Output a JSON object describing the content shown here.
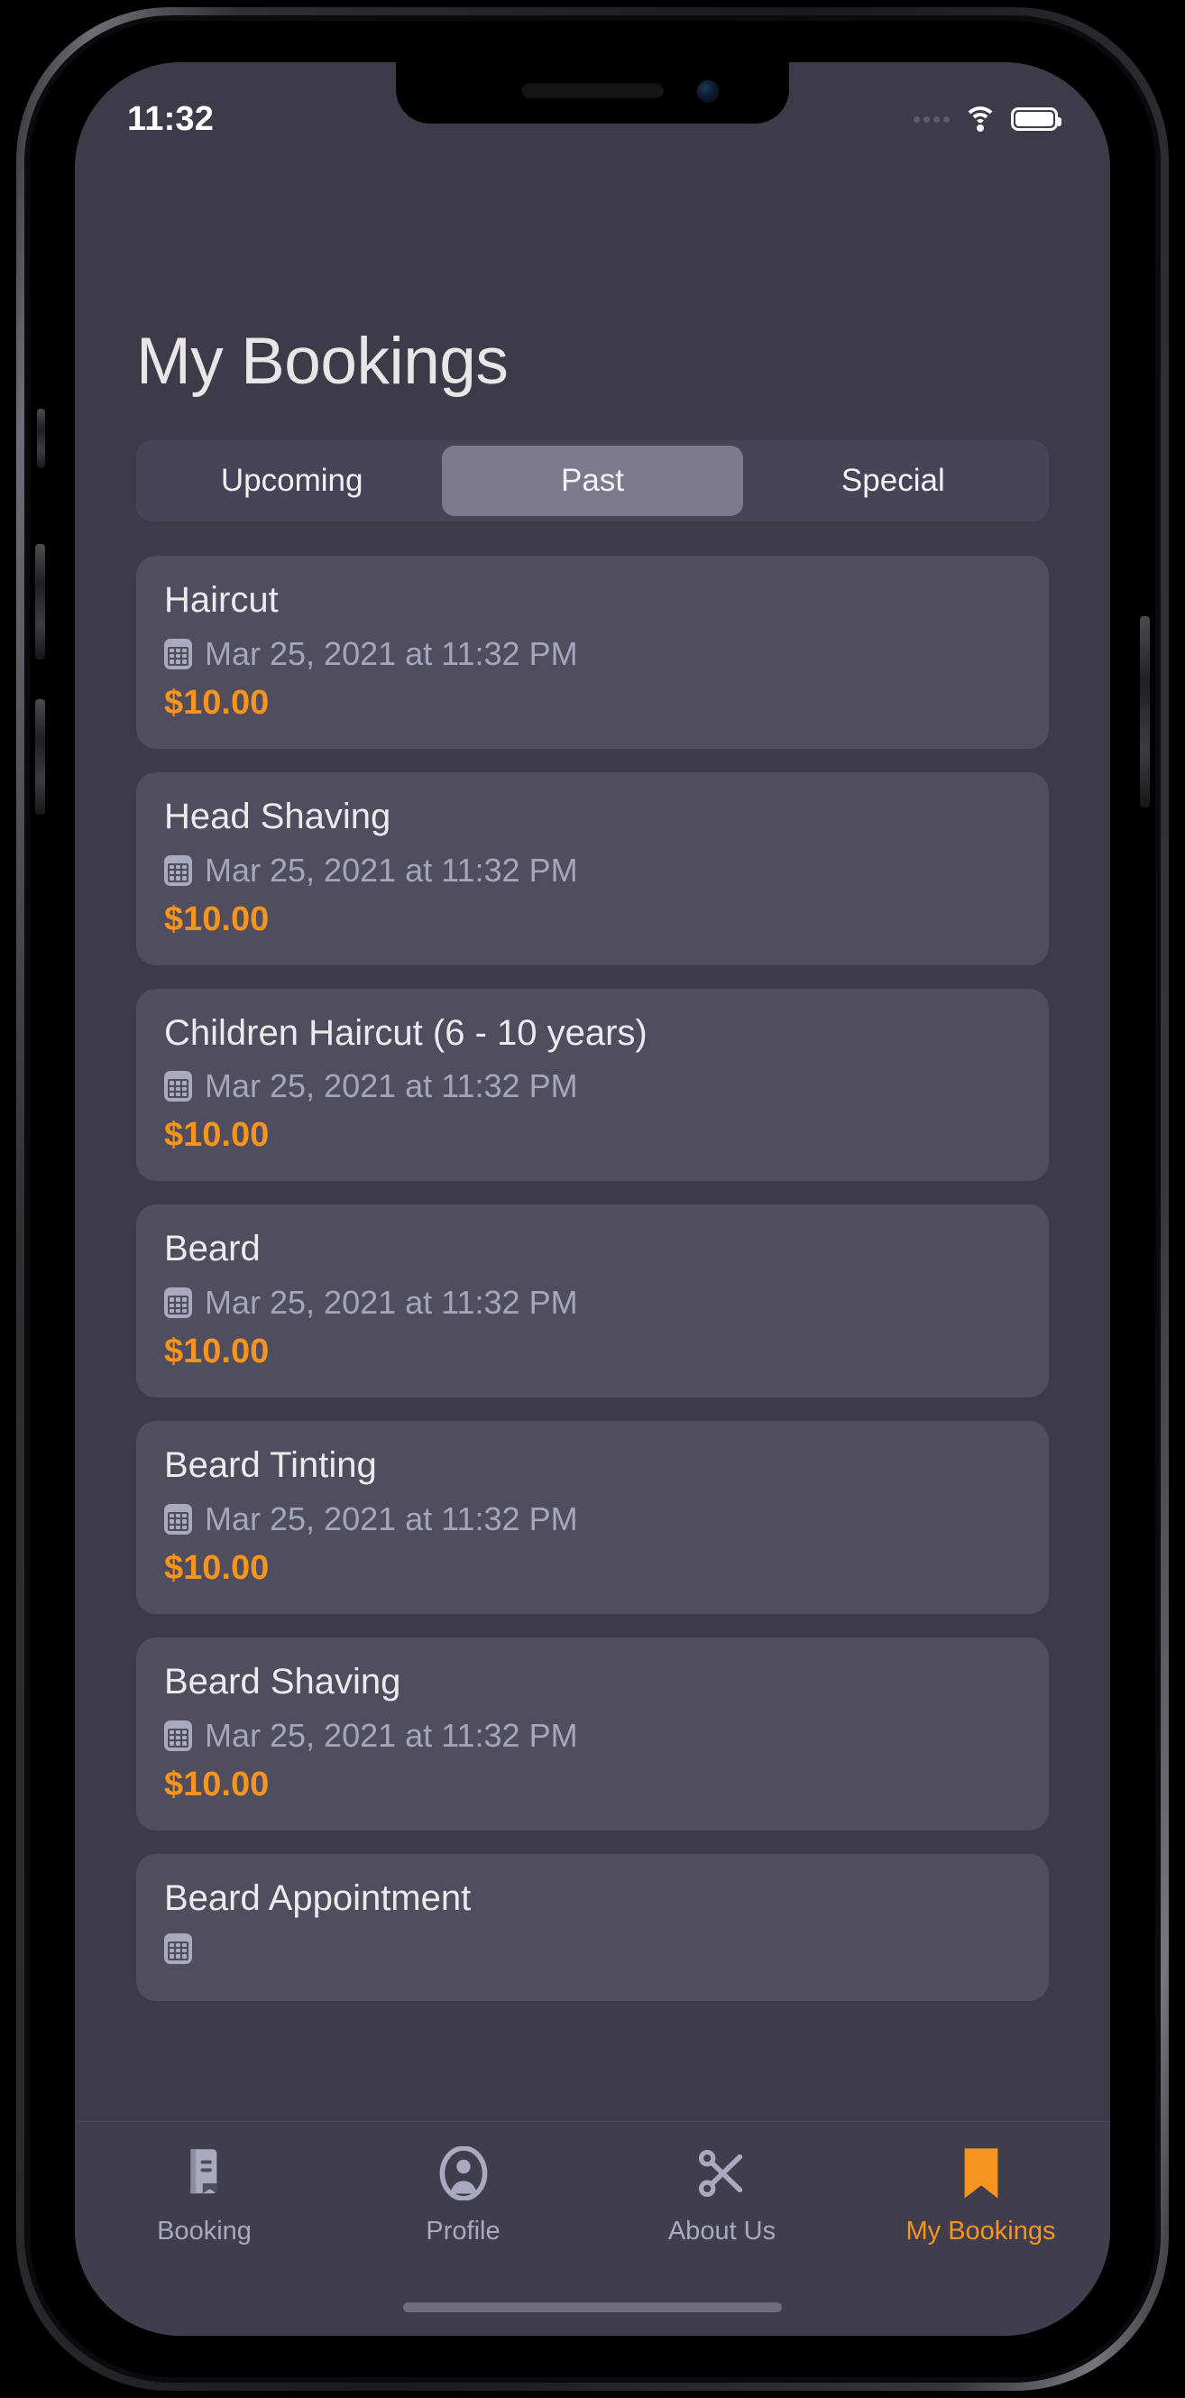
{
  "status_bar": {
    "time": "11:32",
    "signal_icon": "signal-dots-icon",
    "wifi_icon": "wifi-icon",
    "battery_icon": "battery-full-icon"
  },
  "header": {
    "title": "My Bookings"
  },
  "segmented_control": {
    "options": [
      {
        "label": "Upcoming",
        "selected": false
      },
      {
        "label": "Past",
        "selected": true
      },
      {
        "label": "Special",
        "selected": false
      }
    ]
  },
  "bookings": [
    {
      "service": "Haircut",
      "date": "Mar 25, 2021 at 11:32 PM",
      "price": "$10.00"
    },
    {
      "service": "Head Shaving",
      "date": "Mar 25, 2021 at 11:32 PM",
      "price": "$10.00"
    },
    {
      "service": "Children Haircut (6 - 10 years)",
      "date": "Mar 25, 2021 at 11:32 PM",
      "price": "$10.00"
    },
    {
      "service": "Beard",
      "date": "Mar 25, 2021 at 11:32 PM",
      "price": "$10.00"
    },
    {
      "service": "Beard Tinting",
      "date": "Mar 25, 2021 at 11:32 PM",
      "price": "$10.00"
    },
    {
      "service": "Beard Shaving",
      "date": "Mar 25, 2021 at 11:32 PM",
      "price": "$10.00"
    },
    {
      "service": "Beard Appointment",
      "date": "",
      "price": ""
    }
  ],
  "tab_bar": {
    "items": [
      {
        "label": "Booking",
        "icon": "book-icon",
        "active": false
      },
      {
        "label": "Profile",
        "icon": "person-circle-icon",
        "active": false
      },
      {
        "label": "About Us",
        "icon": "scissors-icon",
        "active": false
      },
      {
        "label": "My Bookings",
        "icon": "bookmark-icon",
        "active": true
      }
    ]
  },
  "colors": {
    "accent": "#f5941f",
    "background": "#3d3a4a",
    "card": "#504d5f",
    "segment_track": "#474457",
    "segment_active": "#7d7a8d",
    "muted_text": "#a3a6bd",
    "title_text": "#e8e6e6"
  }
}
